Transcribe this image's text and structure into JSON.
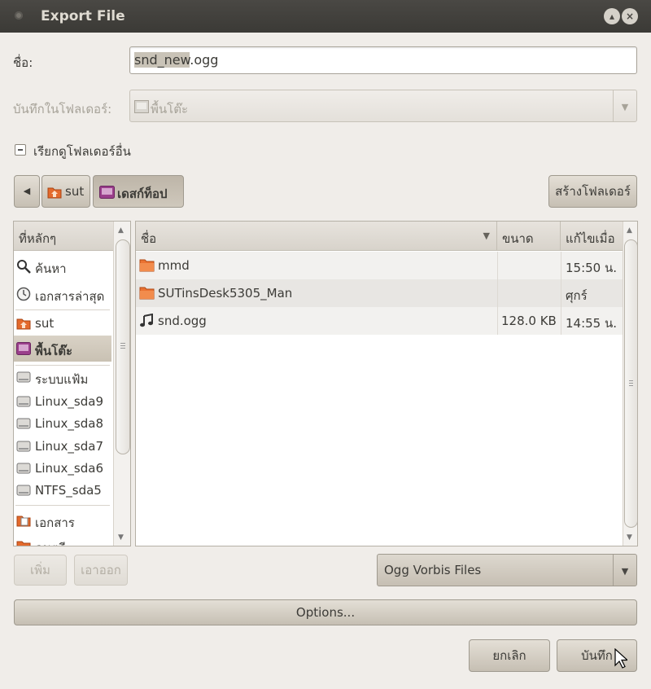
{
  "window": {
    "title": "Export File"
  },
  "form": {
    "name_label": "ชื่อ:",
    "name_value_selected": "snd_new",
    "name_value_rest": ".ogg",
    "save_in_label": "บันทึกในโฟลเดอร์:",
    "save_in_value": "พื้นโต๊ะ",
    "browse_toggle_label": "เรียกดูโฟลเดอร์อื่น"
  },
  "pathbar": {
    "items": [
      {
        "label": "sut"
      },
      {
        "label": "เดสก์ท็อป"
      }
    ],
    "create_folder_label": "สร้างโฟลเดอร์"
  },
  "places": {
    "header": "ที่หลักๆ",
    "items": [
      {
        "label": "ค้นหา",
        "icon": "search-icon"
      },
      {
        "label": "เอกสารล่าสุด",
        "icon": "recent-icon"
      },
      {
        "label": "sut",
        "icon": "home-folder-icon"
      },
      {
        "label": "พื้นโต๊ะ",
        "icon": "desktop-icon"
      },
      {
        "label": "ระบบแฟ้ม",
        "icon": "drive-icon"
      },
      {
        "label": "Linux_sda9",
        "icon": "drive-icon"
      },
      {
        "label": "Linux_sda8",
        "icon": "drive-icon"
      },
      {
        "label": "Linux_sda7",
        "icon": "drive-icon"
      },
      {
        "label": "Linux_sda6",
        "icon": "drive-icon"
      },
      {
        "label": "NTFS_sda5",
        "icon": "drive-icon"
      },
      {
        "label": "เอกสาร",
        "icon": "documents-icon"
      },
      {
        "label": "ดนตรี",
        "icon": "music-folder-icon"
      }
    ],
    "add_label": "เพิ่ม",
    "remove_label": "เอาออก"
  },
  "files": {
    "columns": {
      "name": "ชื่อ",
      "size": "ขนาด",
      "modified": "แก้ไขเมื่อ"
    },
    "rows": [
      {
        "name": "mmd",
        "size": "",
        "modified": "15:50 น.",
        "icon": "folder-icon"
      },
      {
        "name": "SUTinsDesk5305_Man",
        "size": "",
        "modified": "ศุกร์",
        "icon": "folder-icon"
      },
      {
        "name": "snd.ogg",
        "size": "128.0 KB",
        "modified": "14:55 น.",
        "icon": "music-note-icon"
      }
    ]
  },
  "filter": {
    "value": "Ogg Vorbis Files"
  },
  "options_label": "Options...",
  "actions": {
    "cancel_label": "ยกเลิก",
    "save_label": "บันทึก"
  }
}
